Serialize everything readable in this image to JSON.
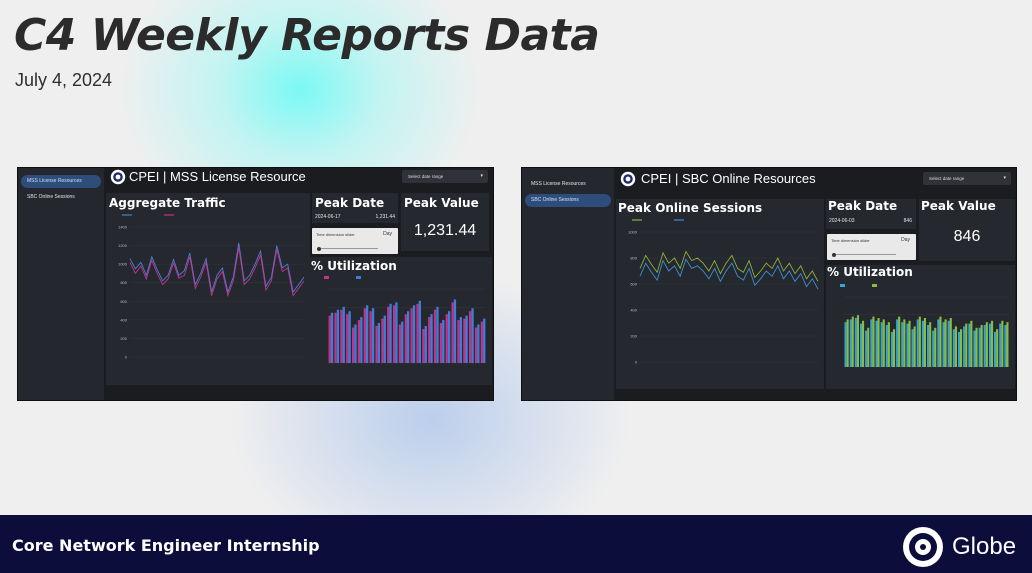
{
  "slide": {
    "title": "C4 Weekly Reports Data",
    "date": "July 4, 2024",
    "footer": "Core Network Engineer Internship",
    "brand": "Globe"
  },
  "dashboards": [
    {
      "nav": [
        "MSS License Resources",
        "SBC Online Sessions"
      ],
      "active_nav": 0,
      "title": "CPEI | MSS License Resource",
      "date_range_label": "Select date range",
      "chart_title": "Aggregate Traffic",
      "peak_date_title": "Peak Date",
      "peak_date": "2024-06-17",
      "peak_date_value": "1,231.44",
      "peak_value_title": "Peak Value",
      "peak_value": "1,231.44",
      "slider_label": "Time dimension slider",
      "slider_value": "Day",
      "utilization_title": "% Utilization"
    },
    {
      "nav": [
        "MSS License Resources",
        "SBC Online Sessions"
      ],
      "active_nav": 1,
      "title": "CPEI | SBC Online Resources",
      "date_range_label": "Select date range",
      "chart_title": "Peak Online Sessions",
      "peak_date_title": "Peak Date",
      "peak_date": "2024-06-03",
      "peak_date_value": "846",
      "peak_value_title": "Peak Value",
      "peak_value": "846",
      "slider_label": "Time dimension slider",
      "slider_value": "Day",
      "utilization_title": "% Utilization"
    }
  ],
  "chart_data": [
    {
      "type": "line",
      "y_ticks": [
        0,
        200,
        400,
        600,
        800,
        1000,
        1200,
        1400
      ],
      "ylim": [
        0,
        1400
      ],
      "series": [
        {
          "color": "#4a7fd4",
          "values": [
            1060,
            950,
            1020,
            880,
            1080,
            940,
            820,
            880,
            1050,
            880,
            930,
            1120,
            780,
            900,
            1060,
            700,
            880,
            960,
            700,
            860,
            1230,
            820,
            880,
            1000,
            1140,
            760,
            860,
            1200,
            960,
            1000,
            700,
            780,
            860
          ]
        },
        {
          "color": "#c2338a",
          "values": [
            1020,
            900,
            980,
            840,
            1040,
            900,
            780,
            840,
            1010,
            850,
            880,
            1080,
            740,
            860,
            1020,
            660,
            840,
            920,
            660,
            820,
            1180,
            780,
            840,
            960,
            1100,
            720,
            820,
            1160,
            920,
            960,
            660,
            740,
            820
          ]
        }
      ]
    },
    {
      "type": "bar",
      "ylim": [
        0,
        5
      ],
      "series": [
        {
          "color": "#c2338a",
          "values": [
            3.2,
            3.4,
            3.6,
            3.3,
            2.4,
            2.9,
            3.7,
            3.5,
            2.5,
            3.0,
            3.8,
            3.9,
            2.6,
            3.3,
            3.7,
            4.0,
            2.3,
            3.1,
            3.6,
            2.7,
            3.3,
            4.1,
            2.9,
            3.0,
            3.5,
            2.4,
            2.8
          ]
        },
        {
          "color": "#3b7fd9",
          "values": [
            3.4,
            3.6,
            3.8,
            3.5,
            2.6,
            3.1,
            3.9,
            3.7,
            2.7,
            3.2,
            4.0,
            4.1,
            2.8,
            3.5,
            3.9,
            4.2,
            2.5,
            3.3,
            3.8,
            2.9,
            3.5,
            4.3,
            3.1,
            3.2,
            3.7,
            2.6,
            3.0
          ]
        }
      ]
    },
    {
      "type": "line",
      "y_ticks": [
        0,
        200,
        400,
        600,
        800,
        1000
      ],
      "ylim": [
        0,
        1000
      ],
      "series": [
        {
          "color": "#8fae3a",
          "values": [
            720,
            820,
            750,
            690,
            840,
            760,
            800,
            720,
            850,
            780,
            800,
            760,
            700,
            780,
            680,
            760,
            820,
            720,
            690,
            780,
            650,
            700,
            760,
            720,
            800,
            700,
            760,
            680,
            740,
            640,
            700,
            620
          ]
        },
        {
          "color": "#3b8fd0",
          "values": [
            660,
            760,
            690,
            630,
            780,
            700,
            740,
            660,
            790,
            720,
            740,
            700,
            640,
            720,
            620,
            700,
            760,
            660,
            630,
            720,
            590,
            640,
            700,
            660,
            740,
            640,
            700,
            620,
            680,
            580,
            640,
            560
          ]
        }
      ]
    },
    {
      "type": "bar",
      "ylim": [
        0,
        0.05
      ],
      "series": [
        {
          "color": "#36a4d8",
          "values": [
            0.032,
            0.034,
            0.035,
            0.031,
            0.026,
            0.034,
            0.033,
            0.032,
            0.03,
            0.025,
            0.034,
            0.032,
            0.031,
            0.027,
            0.034,
            0.033,
            0.03,
            0.026,
            0.034,
            0.032,
            0.033,
            0.027,
            0.025,
            0.029,
            0.031,
            0.026,
            0.028,
            0.03,
            0.031,
            0.025,
            0.031,
            0.03
          ]
        },
        {
          "color": "#8bbd3a",
          "values": [
            0.034,
            0.036,
            0.037,
            0.033,
            0.028,
            0.036,
            0.035,
            0.034,
            0.032,
            0.027,
            0.036,
            0.034,
            0.033,
            0.029,
            0.036,
            0.035,
            0.032,
            0.028,
            0.036,
            0.034,
            0.035,
            0.029,
            0.027,
            0.031,
            0.033,
            0.028,
            0.03,
            0.032,
            0.033,
            0.027,
            0.033,
            0.032
          ]
        }
      ]
    }
  ]
}
